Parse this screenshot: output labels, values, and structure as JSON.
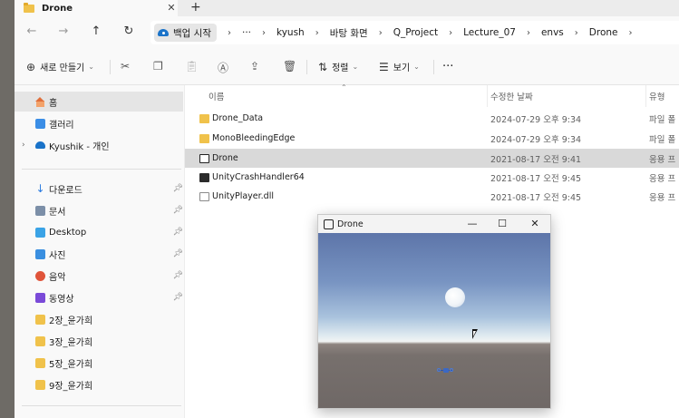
{
  "tab": {
    "title": "Drone",
    "close": "✕",
    "add": "+"
  },
  "nav": {
    "back": "←",
    "forward": "→",
    "up": "↑",
    "refresh": "↻"
  },
  "address": {
    "backup_label": "백업 시작",
    "more": "···",
    "segments": [
      "kyush",
      "바탕 화면",
      "Q_Project",
      "Lecture_07",
      "envs",
      "Drone"
    ],
    "chevron": "›"
  },
  "toolbar": {
    "new_label": "새로 만들기",
    "sort_label": "정렬",
    "view_label": "보기",
    "more": "···"
  },
  "sidebar": {
    "top_items": [
      {
        "label": "홈",
        "icon": "home-icon"
      },
      {
        "label": "갤러리",
        "icon": "gallery-icon"
      },
      {
        "label": "Kyushik - 개인",
        "icon": "onedrive-cloud-icon"
      }
    ],
    "pinned_items": [
      {
        "label": "다운로드",
        "icon": "download-icon"
      },
      {
        "label": "문서",
        "icon": "document-icon"
      },
      {
        "label": "Desktop",
        "icon": "desktop-icon"
      },
      {
        "label": "사진",
        "icon": "photo-icon"
      },
      {
        "label": "음악",
        "icon": "music-icon"
      },
      {
        "label": "동영상",
        "icon": "video-icon"
      }
    ],
    "folder_items": [
      "2장_윤가희",
      "3장_윤가희",
      "5장_윤가희",
      "9장_윤가희"
    ]
  },
  "columns": {
    "name": "이름",
    "modified": "수정한 날짜",
    "type": "유형"
  },
  "files": [
    {
      "name": "Drone_Data",
      "modified": "2024-07-29 오후 9:34",
      "type": "파일 폴",
      "kind": "folder"
    },
    {
      "name": "MonoBleedingEdge",
      "modified": "2024-07-29 오후 9:34",
      "type": "파일 폴",
      "kind": "folder"
    },
    {
      "name": "Drone",
      "modified": "2021-08-17 오전 9:41",
      "type": "응용 프",
      "kind": "unity-app"
    },
    {
      "name": "UnityCrashHandler64",
      "modified": "2021-08-17 오전 9:45",
      "type": "응용 프",
      "kind": "unity-crash"
    },
    {
      "name": "UnityPlayer.dll",
      "modified": "2021-08-17 오전 9:45",
      "type": "응용 프",
      "kind": "dll"
    }
  ],
  "game_window": {
    "title": "Drone",
    "minimize": "—",
    "maximize": "☐",
    "close": "✕"
  },
  "colors": {
    "selected_row": "#d9d9d9",
    "folder": "#f0c24b",
    "sky_top": "#5d75a9",
    "ground": "#6f6866"
  }
}
